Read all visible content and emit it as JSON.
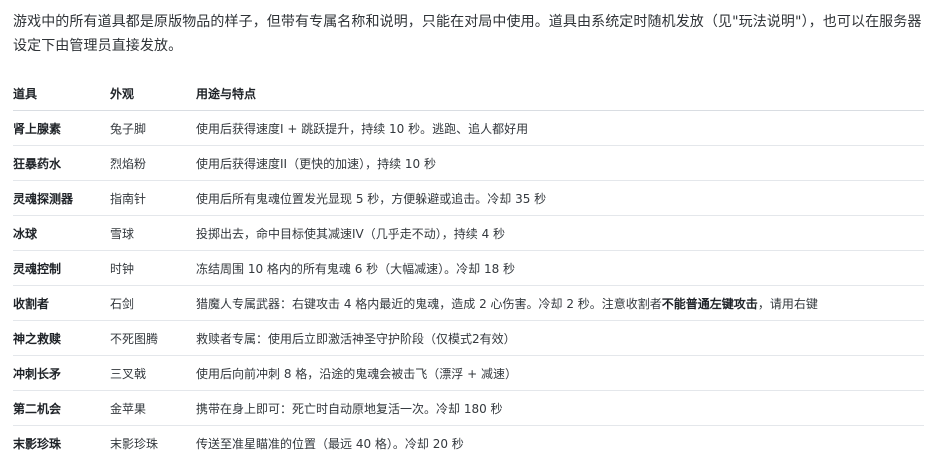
{
  "intro": "游戏中的所有道具都是原版物品的样子，但带有专属名称和说明，只能在对局中使用。道具由系统定时随机发放（见\"玩法说明\"），也可以在服务器设定下由管理员直接发放。",
  "table": {
    "headers": [
      "道具",
      "外观",
      "用途与特点"
    ],
    "rows": [
      {
        "name": "肾上腺素",
        "look": "兔子脚",
        "desc": "使用后获得速度I + 跳跃提升，持续 10 秒。逃跑、追人都好用"
      },
      {
        "name": "狂暴药水",
        "look": "烈焰粉",
        "desc": "使用后获得速度II（更快的加速），持续 10 秒"
      },
      {
        "name": "灵魂探测器",
        "look": "指南针",
        "desc": "使用后所有鬼魂位置发光显现 5 秒，方便躲避或追击。冷却 35 秒"
      },
      {
        "name": "冰球",
        "look": "雪球",
        "desc": "投掷出去，命中目标使其减速IV（几乎走不动），持续 4 秒"
      },
      {
        "name": "灵魂控制",
        "look": "时钟",
        "desc": "冻结周围 10 格内的所有鬼魂 6 秒（大幅减速）。冷却 18 秒"
      },
      {
        "name": "收割者",
        "look": "石剑",
        "desc_before": "猎魔人专属武器：右键攻击 4 格内最近的鬼魂，造成 2 心伤害。冷却 2 秒。注意收割者",
        "desc_bold": "不能普通左键攻击",
        "desc_after": "，请用右键"
      },
      {
        "name": "神之救赎",
        "look": "不死图腾",
        "desc": "救赎者专属：使用后立即激活神圣守护阶段（仅模式2有效）"
      },
      {
        "name": "冲刺长矛",
        "look": "三叉戟",
        "desc": "使用后向前冲刺 8 格，沿途的鬼魂会被击飞（漂浮 + 减速）"
      },
      {
        "name": "第二机会",
        "look": "金苹果",
        "desc": "携带在身上即可：死亡时自动原地复活一次。冷却 180 秒"
      },
      {
        "name": "末影珍珠",
        "look": "末影珍珠",
        "desc": "传送至准星瞄准的位置（最远 40 格）。冷却 20 秒"
      }
    ]
  }
}
